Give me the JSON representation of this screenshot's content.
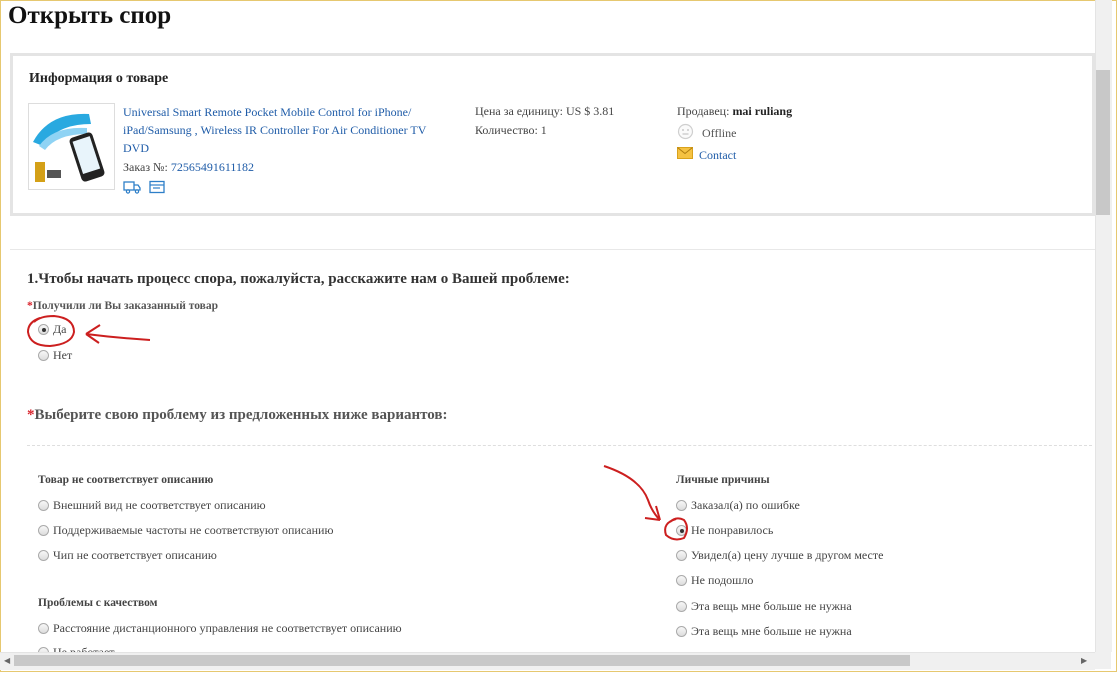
{
  "page": {
    "title": "Открыть спор"
  },
  "product": {
    "section_title": "Информация о товаре",
    "name_line1": "Universal Smart Remote Pocket Mobile Control for iPhone/",
    "name_line2": "iPad/Samsung , Wireless IR Controller For Air Conditioner TV",
    "name_line3": "DVD",
    "order_label": "Заказ №: ",
    "order_number": "72565491611182",
    "price_label": "Цена за единицу: US $ 3.81",
    "quantity_label": "Количество: 1",
    "seller_label": "Продавец: ",
    "seller_name": "mai ruliang",
    "status": "Offline",
    "contact": "Contact"
  },
  "question1": {
    "title": "1.Чтобы начать процесс спора, пожалуйста, расскажите нам о Вашей проблеме:",
    "required_mark": "*",
    "received_label": "Получили ли Вы заказанный товар",
    "options": [
      {
        "label": "Да",
        "checked": true
      },
      {
        "label": "Нет",
        "checked": false
      }
    ]
  },
  "problem": {
    "required_mark": "*",
    "title": "Выберите свою проблему из предложенных ниже вариантов:",
    "groups": {
      "not_as_described": {
        "title": "Товар не соответствует описанию",
        "options": [
          "Внешний вид не соответствует описанию",
          "Поддерживаемые частоты не соответствуют описанию",
          "Чип не соответствует описанию"
        ]
      },
      "quality": {
        "title": "Проблемы с качеством",
        "options": [
          "Расстояние дистанционного управления не соответствует описанию",
          "Не работает"
        ]
      },
      "personal": {
        "title": "Личные причины",
        "options": [
          "Заказал(а) по ошибке",
          "Не понравилось",
          "Увидел(а) цену лучше в другом месте",
          "Не подошло",
          "Эта вещь мне больше не нужна",
          "Эта вещь мне больше не нужна"
        ],
        "checked_index": 1
      }
    }
  },
  "colors": {
    "link": "#1f5ca8",
    "required": "#d9232c",
    "annotation": "#cc1f1f"
  },
  "icons": [
    "shipping-icon",
    "document-icon",
    "offline-status-icon",
    "mail-icon",
    "scroll-left-icon",
    "scroll-right-icon"
  ]
}
